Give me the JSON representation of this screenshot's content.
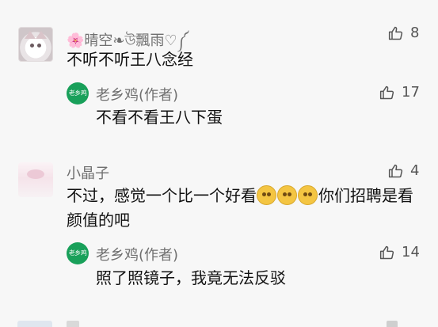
{
  "colors": {
    "background": "#f7f7f7",
    "name_gray": "#6f6f6f",
    "text_black": "#111111",
    "author_green": "#19a05a",
    "like_gray": "#555555"
  },
  "comments": [
    {
      "name": "🌸晴空❧উ飄雨♡༼",
      "text": "不听不听王八念经",
      "likes": "8",
      "like_icon": "thumbs-up-icon",
      "reply": {
        "name": "老乡鸡(作者)",
        "avatar_text": "老乡鸡",
        "text": "不看不看王八下蛋",
        "likes": "17",
        "like_icon": "thumbs-up-icon"
      }
    },
    {
      "name": "小晶子",
      "text_part1": "不过，感觉一个比一个好看",
      "text_part2": "你们招聘是看颜值的吧",
      "emoji_icon": "smirk-emoji-icon",
      "likes": "4",
      "like_icon": "thumbs-up-icon",
      "reply": {
        "name": "老乡鸡(作者)",
        "avatar_text": "老乡鸡",
        "text": "照了照镜子，我竟无法反驳",
        "likes": "14",
        "like_icon": "thumbs-up-icon"
      }
    }
  ]
}
